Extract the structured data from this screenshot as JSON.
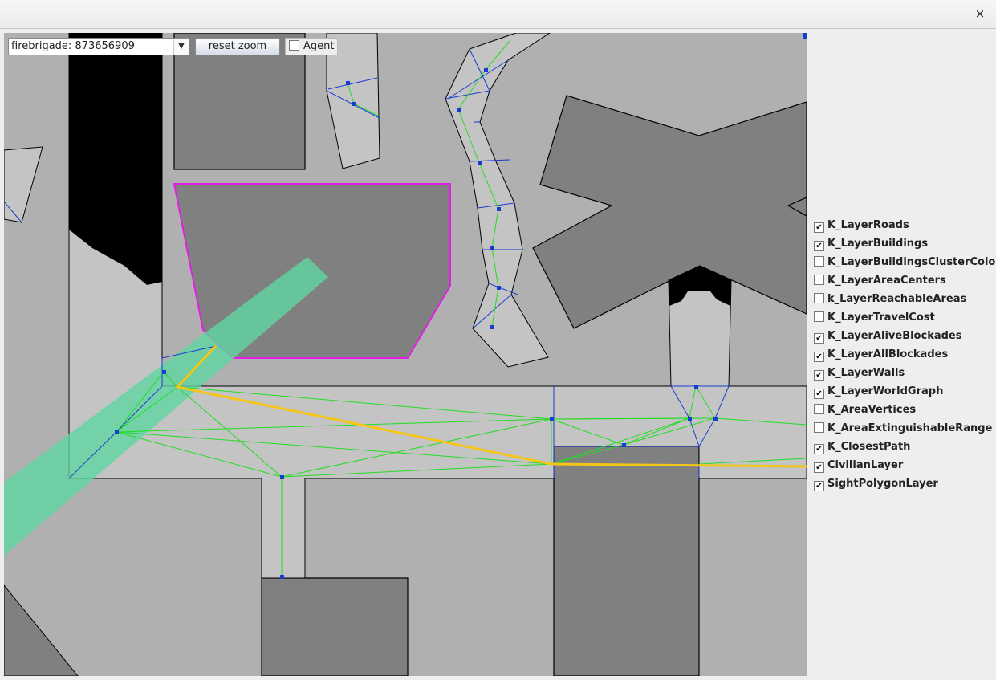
{
  "window": {
    "close_icon": "×"
  },
  "toolbar": {
    "agent_select_value": "firebrigade: 873656909",
    "dropdown_arrow_icon": "▼",
    "reset_zoom_label": "reset zoom",
    "agent_checkbox_label": "Agent",
    "agent_checkbox_checked": false
  },
  "layers": [
    {
      "label": "K_LayerRoads",
      "checked": true
    },
    {
      "label": "K_LayerBuildings",
      "checked": true
    },
    {
      "label": "K_LayerBuildingsClusterColor",
      "checked": false
    },
    {
      "label": "K_LayerAreaCenters",
      "checked": false
    },
    {
      "label": "k_LayerReachableAreas",
      "checked": false
    },
    {
      "label": "K_LayerTravelCost",
      "checked": false
    },
    {
      "label": "K_LayerAliveBlockades",
      "checked": true
    },
    {
      "label": "K_LayerAllBlockades",
      "checked": true
    },
    {
      "label": "K_LayerWalls",
      "checked": true
    },
    {
      "label": "K_LayerWorldGraph",
      "checked": true
    },
    {
      "label": "K_AreaVertices",
      "checked": false
    },
    {
      "label": "K_AreaExtinguishableRange",
      "checked": false
    },
    {
      "label": "K_ClosestPath",
      "checked": true
    },
    {
      "label": "CivilianLayer",
      "checked": true
    },
    {
      "label": "SightPolygonLayer",
      "checked": true
    }
  ],
  "colors": {
    "map_background": "#b0b0b0",
    "road": "#c4c4c4",
    "building": "#808080",
    "blockade": "#000000",
    "selected_building_outline": "#e020e0",
    "graph_edge": "#22dd22",
    "graph_node": "#1a3bd0",
    "closest_path": "#f5c518",
    "sight_polygon": "#5fd6a0"
  }
}
